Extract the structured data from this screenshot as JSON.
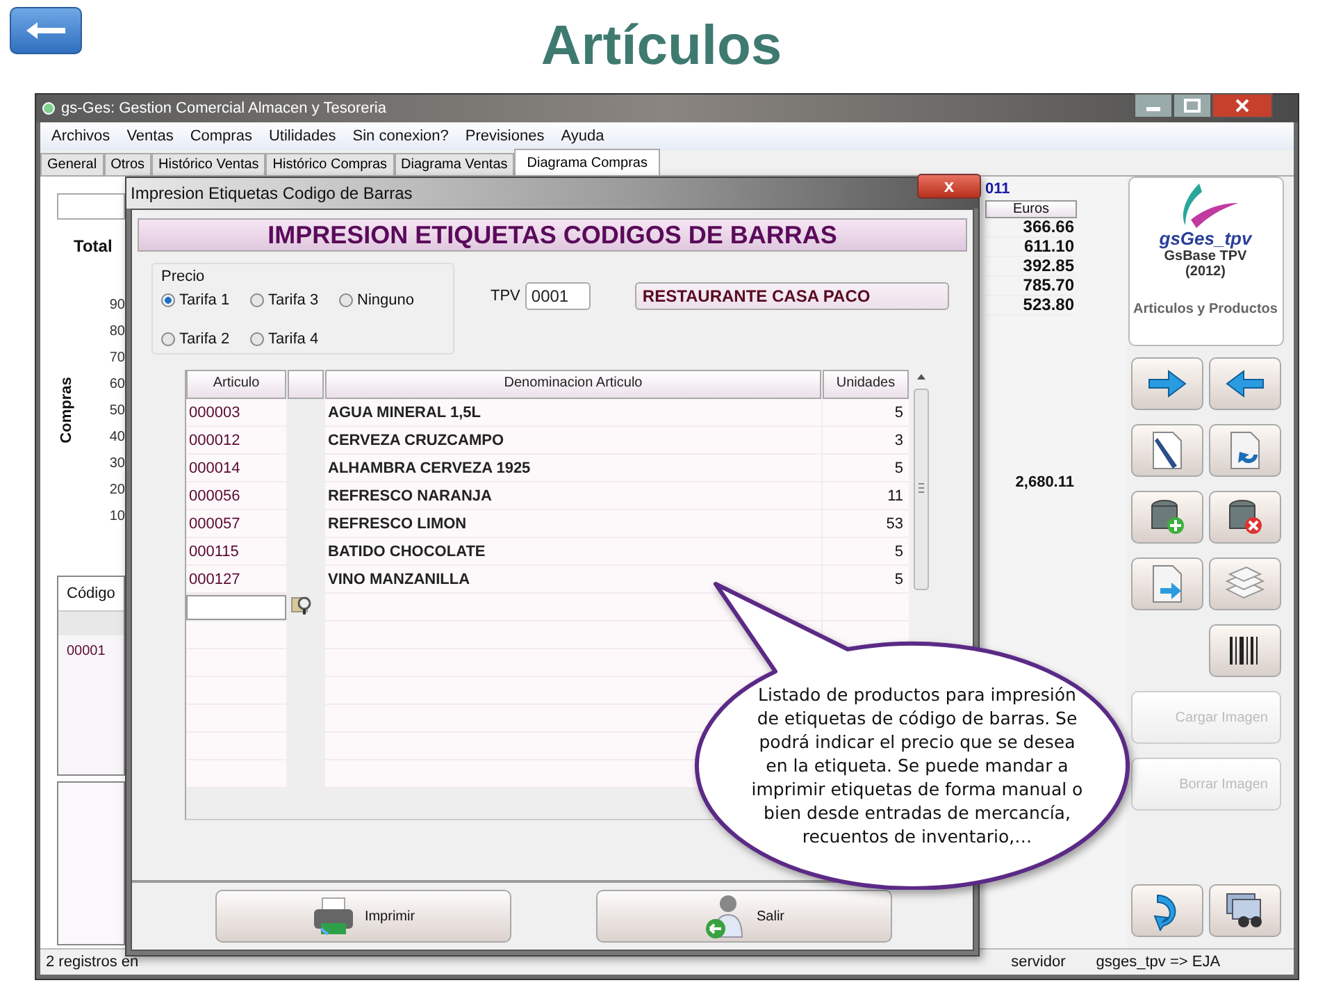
{
  "header": {
    "title": "Artículos"
  },
  "main_window": {
    "title": "gs-Ges: Gestion Comercial Almacen y Tesoreria",
    "menu": [
      "Archivos",
      "Ventas",
      "Compras",
      "Utilidades",
      "Sin conexion?",
      "Previsiones",
      "Ayuda"
    ],
    "tabs": [
      {
        "label": "General",
        "selected": false
      },
      {
        "label": "Otros",
        "selected": false
      },
      {
        "label": "Histórico Ventas",
        "selected": false
      },
      {
        "label": "Histórico Compras",
        "selected": false
      },
      {
        "label": "Diagrama Ventas",
        "selected": false
      },
      {
        "label": "Diagrama Compras",
        "selected": true
      }
    ],
    "chart": {
      "title": "Total",
      "ylabel": "Compras",
      "yticks": [
        "90",
        "80",
        "70",
        "60",
        "50",
        "40",
        "30",
        "20",
        "10"
      ]
    },
    "codes_table": {
      "columns": [
        "Código"
      ],
      "rows": [
        "00001"
      ]
    },
    "year_table": {
      "title": "011",
      "columns": [
        "Euros"
      ],
      "rows": [
        "366.66",
        "611.10",
        "392.85",
        "785.70",
        "523.80"
      ],
      "total": "2,680.11"
    },
    "side_panel": {
      "brand": "gsGes_tpv",
      "product": "GsBase TPV",
      "year": "(2012)",
      "module": "Articulos y Productos",
      "image_buttons": [
        {
          "label": "Cargar Imagen",
          "disabled": true
        },
        {
          "label": "Borrar Imagen",
          "disabled": true
        }
      ]
    },
    "status_bar": [
      "2 registros en",
      "servidor",
      "gsges_tpv => EJA"
    ]
  },
  "dialog": {
    "title": "Impresion Etiquetas Codigo de Barras",
    "close": "x",
    "heading": "IMPRESION ETIQUETAS CODIGOS DE BARRAS",
    "precio": {
      "label": "Precio",
      "options": [
        {
          "label": "Tarifa 1",
          "selected": true
        },
        {
          "label": "Tarifa 3",
          "selected": false
        },
        {
          "label": "Ninguno",
          "selected": false
        },
        {
          "label": "Tarifa 2",
          "selected": false
        },
        {
          "label": "Tarifa 4",
          "selected": false
        }
      ]
    },
    "tpv": {
      "label": "TPV",
      "value": "0001",
      "name": "RESTAURANTE CASA PACO"
    },
    "table": {
      "columns": [
        "Articulo",
        "Denominacion Articulo",
        "Unidades"
      ],
      "rows": [
        {
          "articulo": "000003",
          "denominacion": "AGUA MINERAL 1,5L",
          "unidades": "5"
        },
        {
          "articulo": "000012",
          "denominacion": "CERVEZA CRUZCAMPO",
          "unidades": "3"
        },
        {
          "articulo": "000014",
          "denominacion": "ALHAMBRA CERVEZA 1925",
          "unidades": "5"
        },
        {
          "articulo": "000056",
          "denominacion": "REFRESCO NARANJA",
          "unidades": "11"
        },
        {
          "articulo": "000057",
          "denominacion": "REFRESCO LIMON",
          "unidades": "53"
        },
        {
          "articulo": "000115",
          "denominacion": "BATIDO CHOCOLATE",
          "unidades": "5"
        },
        {
          "articulo": "000127",
          "denominacion": "VINO MANZANILLA",
          "unidades": "5"
        }
      ]
    },
    "buttons": [
      {
        "kind": "print",
        "label": "Imprimir"
      },
      {
        "kind": "exit",
        "label": "Salir"
      }
    ]
  },
  "callout": {
    "text": "Listado de productos para impresión de etiquetas de código de barras. Se podrá indicar el precio que se desea en la etiqueta. Se puede mandar a imprimir etiquetas de forma manual o bien desde entradas de mercancía, recuentos de inventario,…"
  }
}
